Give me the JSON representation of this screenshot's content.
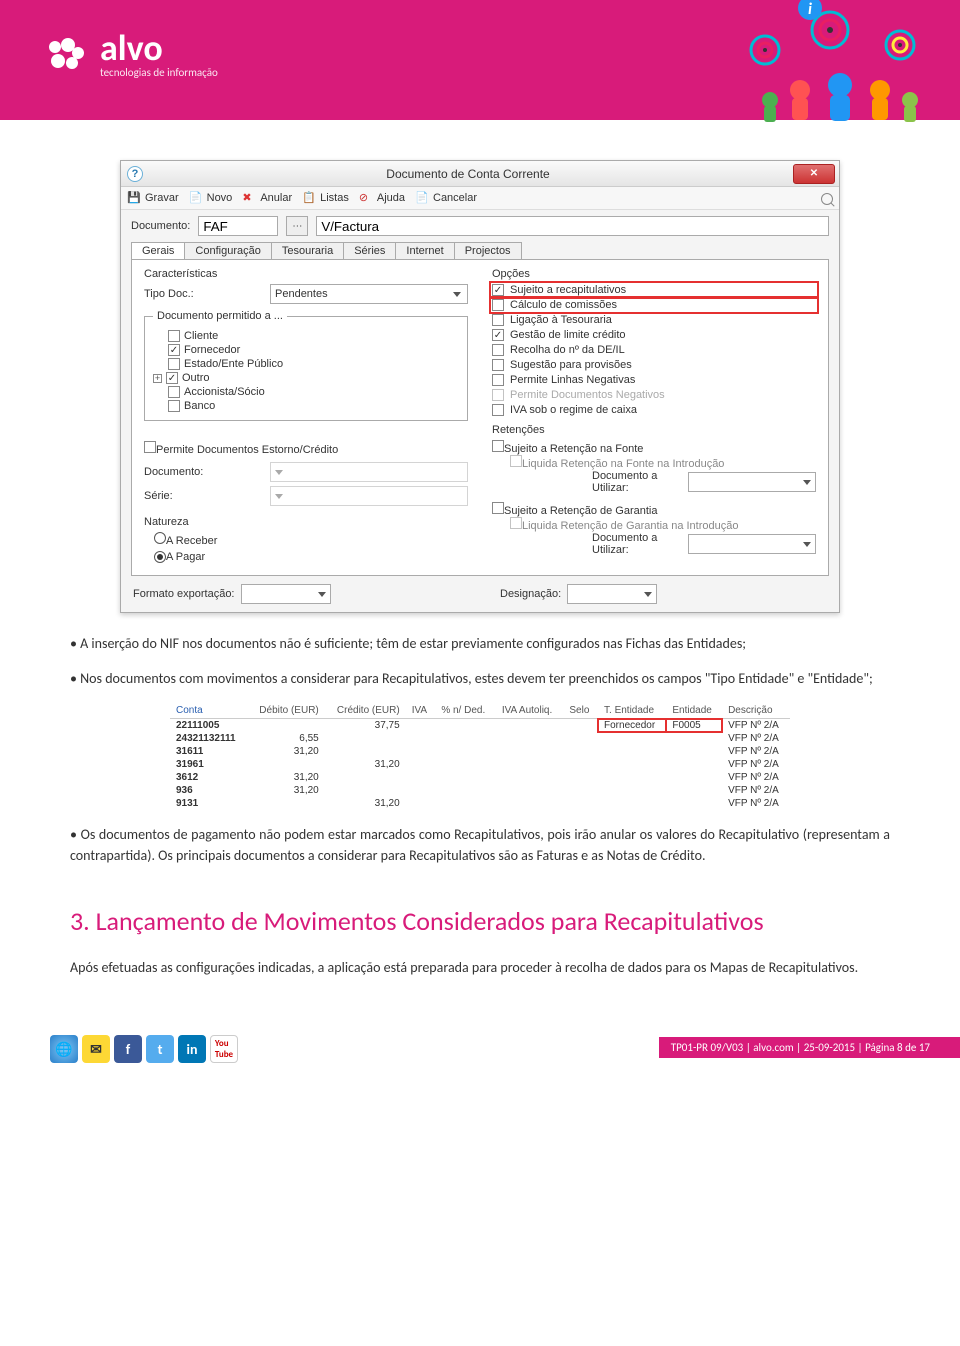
{
  "header": {
    "brand": "alvo",
    "tagline": "tecnologias de informação"
  },
  "dialog": {
    "title": "Documento de Conta Corrente",
    "toolbar": {
      "gravar": "Gravar",
      "novo": "Novo",
      "anular": "Anular",
      "listas": "Listas",
      "ajuda": "Ajuda",
      "cancelar": "Cancelar"
    },
    "documento_label": "Documento:",
    "documento_code": "FAF",
    "documento_desc": "V/Factura",
    "tabs": [
      "Gerais",
      "Configuração",
      "Tesouraria",
      "Séries",
      "Internet",
      "Projectos"
    ],
    "caracteristicas_title": "Características",
    "tipo_doc_label": "Tipo Doc.:",
    "tipo_doc_value": "Pendentes",
    "permitido_label": "Documento permitido a ...",
    "tree": [
      "Cliente",
      "Fornecedor",
      "Estado/Ente Público",
      "Outro",
      "Accionista/Sócio",
      "Banco"
    ],
    "tree_checked": [
      false,
      true,
      false,
      true,
      false,
      false
    ],
    "tree_expandable": [
      false,
      false,
      false,
      true,
      false,
      false
    ],
    "opcoes_title": "Opções",
    "opcoes": [
      {
        "label": "Sujeito a recapitulativos",
        "checked": true,
        "highlight": true
      },
      {
        "label": "Cálculo de comissões",
        "checked": false,
        "highlight": true
      },
      {
        "label": "Ligação à Tesouraria",
        "checked": false
      },
      {
        "label": "Gestão de limite crédito",
        "checked": true
      },
      {
        "label": "Recolha do nº da DE/IL",
        "checked": false
      },
      {
        "label": "Sugestão para provisões",
        "checked": false
      },
      {
        "label": "Permite Linhas Negativas",
        "checked": false
      },
      {
        "label": "Permite Documentos Negativos",
        "checked": false,
        "disabled": true
      },
      {
        "label": "IVA sob o regime de caixa",
        "checked": false
      }
    ],
    "storno_label": "Permite Documentos Estorno/Crédito",
    "storno_doc": "Documento:",
    "storno_serie": "Série:",
    "retencoes_title": "Retenções",
    "ret1": "Sujeito a Retenção na Fonte",
    "ret1b": "Liquida Retenção na Fonte na Introdução",
    "util_label": "Documento a Utilizar:",
    "ret2": "Sujeito a Retenção de Garantia",
    "ret2b": "Liquida Retenção de Garantia na Introdução",
    "natureza_title": "Natureza",
    "nat_receber": "A Receber",
    "nat_pagar": "A Pagar",
    "formato_label": "Formato exportação:",
    "designacao_label": "Designação:"
  },
  "body": {
    "p1": "A inserção do NIF nos documentos não é suficiente; têm de estar previamente configurados nas Fichas das Entidades;",
    "p2": "Nos documentos com movimentos a considerar para Recapitulativos, estes devem ter preenchidos os campos \"Tipo Entidade\" e \"Entidade\";",
    "p3": "Os documentos de pagamento não podem estar marcados como Recapitulativos, pois irão anular os valores do Recapitulativo (representam a contrapartida). Os principais documentos a considerar para Recapitulativos são as Faturas e as Notas de Crédito."
  },
  "chart_data": {
    "type": "table",
    "columns": [
      "Conta",
      "Débito (EUR)",
      "Crédito (EUR)",
      "IVA",
      "% n/ Ded.",
      "IVA Autoliq.",
      "Selo",
      "T. Entidade",
      "Entidade",
      "Descrição"
    ],
    "rows": [
      {
        "Conta": "22111005",
        "Débito (EUR)": "",
        "Crédito (EUR)": "37,75",
        "T. Entidade": "Fornecedor",
        "Entidade": "F0005",
        "Descrição": "VFP Nº 2/A",
        "highlight_entity": true
      },
      {
        "Conta": "24321132111",
        "Débito (EUR)": "6,55",
        "Crédito (EUR)": "",
        "Descrição": "VFP Nº 2/A"
      },
      {
        "Conta": "31611",
        "Débito (EUR)": "31,20",
        "Crédito (EUR)": "",
        "Descrição": "VFP Nº 2/A"
      },
      {
        "Conta": "31961",
        "Débito (EUR)": "",
        "Crédito (EUR)": "31,20",
        "Descrição": "VFP Nº 2/A"
      },
      {
        "Conta": "3612",
        "Débito (EUR)": "31,20",
        "Crédito (EUR)": "",
        "Descrição": "VFP Nº 2/A"
      },
      {
        "Conta": "936",
        "Débito (EUR)": "31,20",
        "Crédito (EUR)": "",
        "Descrição": "VFP Nº 2/A"
      },
      {
        "Conta": "9131",
        "Débito (EUR)": "",
        "Crédito (EUR)": "31,20",
        "Descrição": "VFP Nº 2/A"
      }
    ]
  },
  "section": {
    "heading": "3. Lançamento de Movimentos Considerados para Recapitulativos",
    "p": "Após efetuadas as configurações indicadas, a aplicação está preparada para proceder à recolha de dados para os Mapas de Recapitulativos."
  },
  "footer": {
    "text": "TP01-PR 09/V03 | alvo.com | 25-09-2015 | Página 8 de 17"
  }
}
